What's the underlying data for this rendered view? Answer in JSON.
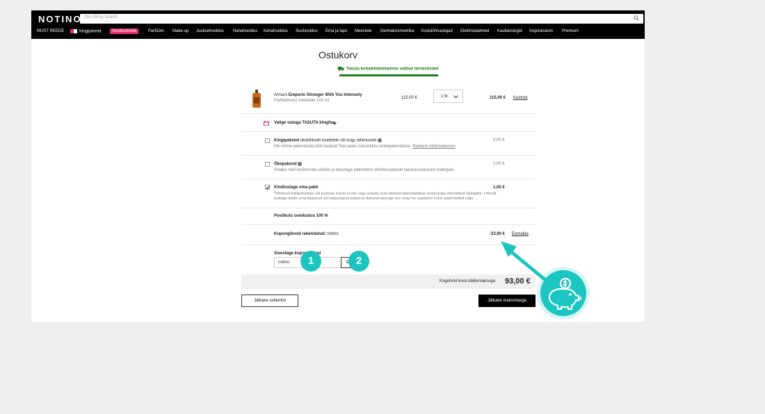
{
  "header": {
    "logo": "NOTINO",
    "search_placeholder": "Otsi lõhna, brändi..."
  },
  "nav": {
    "items": [
      "MUST REEDE",
      "Kingijuhend",
      "Soodusmüük",
      "Parfüüm",
      "Make-up",
      "Juuksehooldus",
      "Nahahooldus",
      "Kehahooldus",
      "Suuhooldus",
      "Ema ja laps",
      "Meestele",
      "Dermakosmeetika",
      "Kodulõhnastajad",
      "Elektriseadmed",
      "Kaubamärgid",
      "Inspiratsioon",
      "Premium"
    ]
  },
  "cart": {
    "title": "Ostukorv",
    "free_shipping": "Tasuta kohaletoimetamine valitud tarneviisidel",
    "product": {
      "brand": "Armani",
      "name": "Emporio Stronger With You Intensely",
      "desc": "Parfüümvesi meestele 100 ml",
      "unit_price": "115,00 €",
      "qty": "1 tk",
      "total": "115,00 €",
      "remove": "Kustuta"
    },
    "gift_choose": "Valige ostuga TASUTA kingitus",
    "options": [
      {
        "title": "Kingipakend",
        "subtitle": "ükskõikselt toodetele või kogu tellimusele",
        "desc": "Me võime pakendada kõik kaubad Teie jaoks luksuslikku kinkepakendisse.",
        "link": "Rohkem informatsiooni",
        "price": "5,00 €",
        "checked": false
      },
      {
        "title": "Ökopakend",
        "subtitle": "",
        "desc": "Aidake meil keskkonda säästa ja kasutage pakendina plastikuvabasid taaskasutatavaid materjale.",
        "link": "",
        "price": "1,00 €",
        "checked": false
      },
      {
        "title": "Kindlustage oma pakk",
        "subtitle": "",
        "desc": "Tellimuse kahjustumise või kaotuse korral ei oke vaja oodata, kuni diskord lahendatakse seadusega ettenähtud tähtajaks. Lihtsalt",
        "desc2": "teatage meile oma kadunud või kahjustatud paktst ja dokumenteerige see ning me saadame kohe uued tooted välja.",
        "link": "",
        "price": "1,00 €",
        "checked": true
      }
    ],
    "postage_discount": "Postikulu soodustus 100 %",
    "coupon_applied_label": "Kupongikood rakendatud:",
    "coupon_applied_code": "notino",
    "coupon_discount": "-23,00 €",
    "coupon_remove": "Eemalda",
    "coupon_enter_label": "Sisestage kupongikood",
    "coupon_value": "notino",
    "coupon_button": "OK",
    "total_label": "Koguhind koos käibemaksuga",
    "total_value": "93,00 €",
    "back_button": "Jätkake ostlemist",
    "pay_button": "Jätkake maksmisega"
  },
  "annotations": {
    "step1": "1",
    "step2": "2",
    "accent_color": "#1cc5c0"
  }
}
